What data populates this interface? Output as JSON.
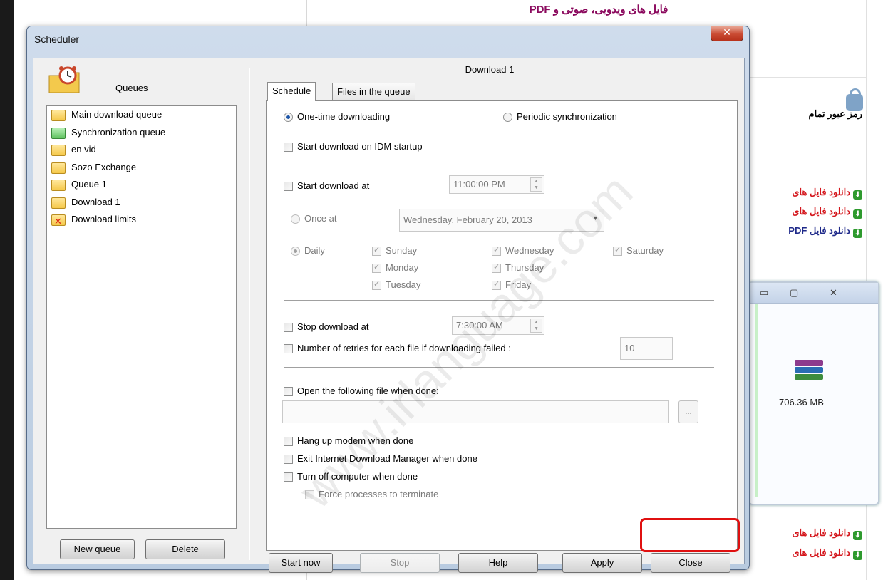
{
  "background_page": {
    "header": "فایل های ویدویی، صوتی و PDF",
    "side_title": "رمز عبور تمام",
    "links_top": [
      "دانلود فایل های",
      "دانلود فایل های",
      "دانلود فایل PDF"
    ],
    "links_bottom": [
      "دانلود فایل های",
      "دانلود فایل های"
    ],
    "rar_size": "706.36 MB"
  },
  "dialog": {
    "title": "Scheduler",
    "close_glyph": "✕"
  },
  "left": {
    "queues_label": "Queues",
    "queues": [
      {
        "label": "Main download queue",
        "icon": "folder-icon"
      },
      {
        "label": "Synchronization queue",
        "icon": "sync-folder-icon"
      },
      {
        "label": "en vid",
        "icon": "folder-icon"
      },
      {
        "label": "Sozo Exchange",
        "icon": "folder-icon"
      },
      {
        "label": "Queue 1",
        "icon": "folder-icon"
      },
      {
        "label": "Download 1",
        "icon": "folder-icon"
      },
      {
        "label": "Download limits",
        "icon": "limits-icon"
      }
    ],
    "new_queue": "New queue",
    "delete": "Delete"
  },
  "right": {
    "queue_title": "Download 1",
    "tabs": [
      "Schedule",
      "Files in the queue"
    ],
    "one_time": "One-time downloading",
    "periodic": "Periodic synchronization",
    "start_on_startup": "Start download on IDM startup",
    "start_at": "Start download at",
    "start_time": "11:00:00 PM",
    "once_at": "Once at",
    "once_date": "Wednesday,  February  20, 2013",
    "daily": "Daily",
    "days": [
      "Sunday",
      "Monday",
      "Tuesday",
      "Wednesday",
      "Thursday",
      "Friday",
      "Saturday"
    ],
    "stop_at": "Stop download at",
    "stop_time": "7:30:00 AM",
    "retries": "Number of retries for each file if downloading failed :",
    "retries_value": "10",
    "open_file": "Open the following file when done:",
    "browse": "...",
    "hang_up": "Hang up modem when done",
    "exit_idm": "Exit Internet Download Manager when done",
    "turn_off": "Turn off computer when done",
    "force": "Force processes to terminate"
  },
  "buttons": {
    "start_now": "Start now",
    "stop": "Stop",
    "help": "Help",
    "apply": "Apply",
    "close": "Close"
  },
  "watermark": "www.irlanguage.com"
}
